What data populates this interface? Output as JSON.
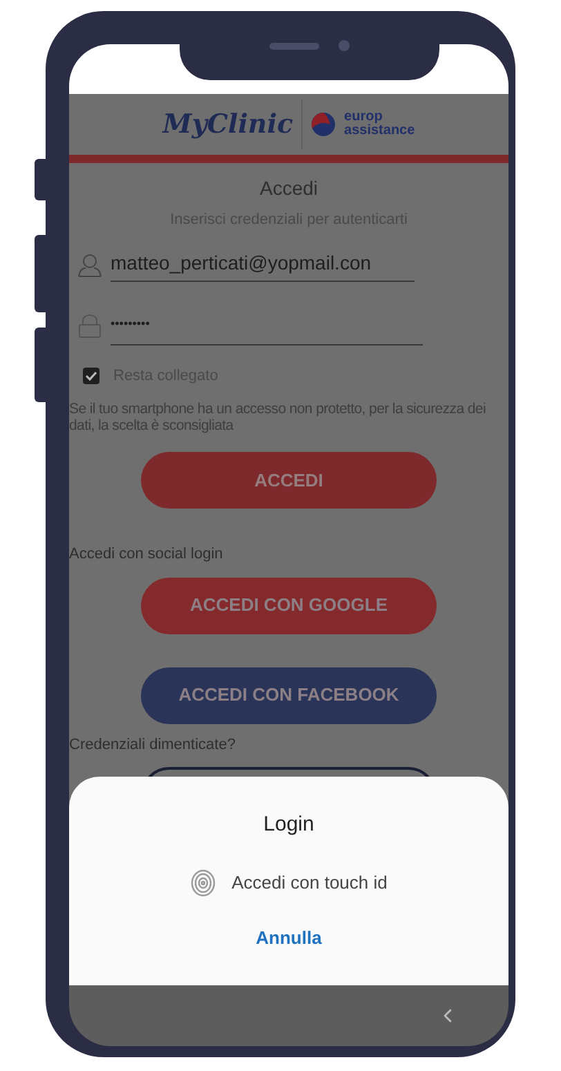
{
  "header": {
    "brand": "MyClinic",
    "partner_top": "europ",
    "partner_bottom": "assistance"
  },
  "title": "Accedi",
  "subtitle": "Inserisci credenziali per autenticarti",
  "email_field": {
    "value": "matteo_perticati@yopmail.con"
  },
  "password_field": {
    "value": "•••••••••"
  },
  "remember": {
    "label": "Resta collegato",
    "checked": true
  },
  "warning": "Se il tuo smartphone ha un accesso non protetto, per la sicurezza dei dati, la scelta è sconsigliata",
  "login_button": {
    "label": "ACCEDI"
  },
  "social": {
    "label": "Accedi con social login",
    "buttons": [
      {
        "kind": "google",
        "label": "ACCEDI CON GOOGLE"
      },
      {
        "kind": "facebook",
        "label": "ACCEDI CON FACEBOOK"
      }
    ]
  },
  "forgot": {
    "label": "Credenziali dimenticate?"
  },
  "dialog": {
    "title": "Login",
    "option": "Accedi con touch id",
    "cancel": "Annulla"
  }
}
